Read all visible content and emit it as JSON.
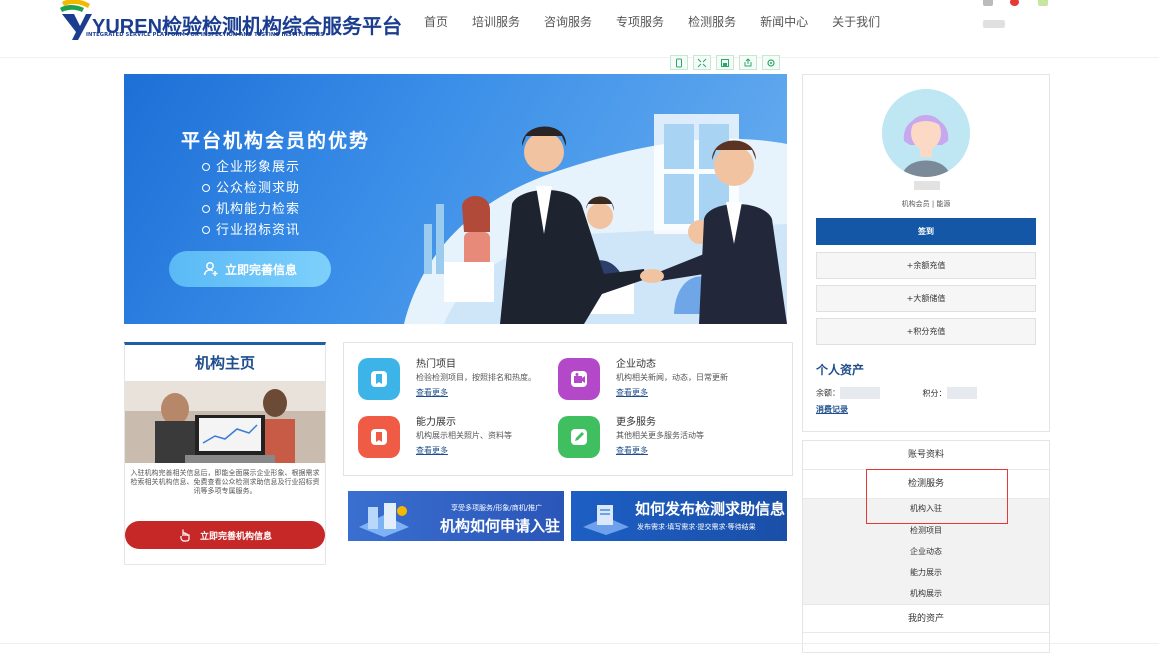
{
  "header": {
    "logo_title": "YUREN检验检测机构综合服务平台",
    "logo_subtitle": "INTEGRATED SERVICE PLATFORM FOR INSPECTION AND TESTING INSTITUTIONS",
    "nav": [
      "首页",
      "培训服务",
      "咨询服务",
      "专项服务",
      "检测服务",
      "新闻中心",
      "关于我们"
    ]
  },
  "banner": {
    "title": "平台机构会员的优势",
    "items": [
      "企业形象展示",
      "公众检测求助",
      "机构能力检索",
      "行业招标资讯"
    ],
    "button": "立即完善信息"
  },
  "org_card": {
    "title": "机构主页",
    "text": "入驻机构完善相关信息后，即能全面展示企业形象、根据需求检索相关机构信息、免费查看公众检测求助信息及行业招标资讯等多项专属服务。",
    "button": "立即完善机构信息"
  },
  "services": [
    {
      "name": "热门项目",
      "desc": "检验检测项目，按照排名和热度。",
      "more": "查看更多",
      "color": "#3db4e8",
      "icon": "book-icon"
    },
    {
      "name": "企业动态",
      "desc": "机构相关新闻，动态，日常更新",
      "more": "查看更多",
      "color": "#b348c9",
      "icon": "video-icon"
    },
    {
      "name": "能力展示",
      "desc": "机构展示相关照片、资料等",
      "more": "查看更多",
      "color": "#ef5b45",
      "icon": "book-icon"
    },
    {
      "name": "更多服务",
      "desc": "其他相关更多服务活动等",
      "more": "查看更多",
      "color": "#3fbf5f",
      "icon": "edit-icon"
    }
  ],
  "promos": [
    {
      "small": "享受多项服务/形象/商机/推广",
      "big": "机构如何申请入驻"
    },
    {
      "big": "如何发布检测求助信息",
      "small": "发布需求·填写需求·提交需求·等待结果"
    }
  ],
  "profile": {
    "role": "机构会员 | 能源",
    "sign_button": "签到",
    "buttons": [
      "+余额充值",
      "+大额储值",
      "+积分充值"
    ],
    "assets_title": "个人资产",
    "balance_label": "余额：",
    "points_label": "积分：",
    "consume_link": "消费记录"
  },
  "menu": {
    "account": "账号资料",
    "testing": "检测服务",
    "sub_items": [
      "机构入驻",
      "检测项目",
      "企业动态",
      "能力展示",
      "机构展示"
    ],
    "assets": "我的资产"
  }
}
